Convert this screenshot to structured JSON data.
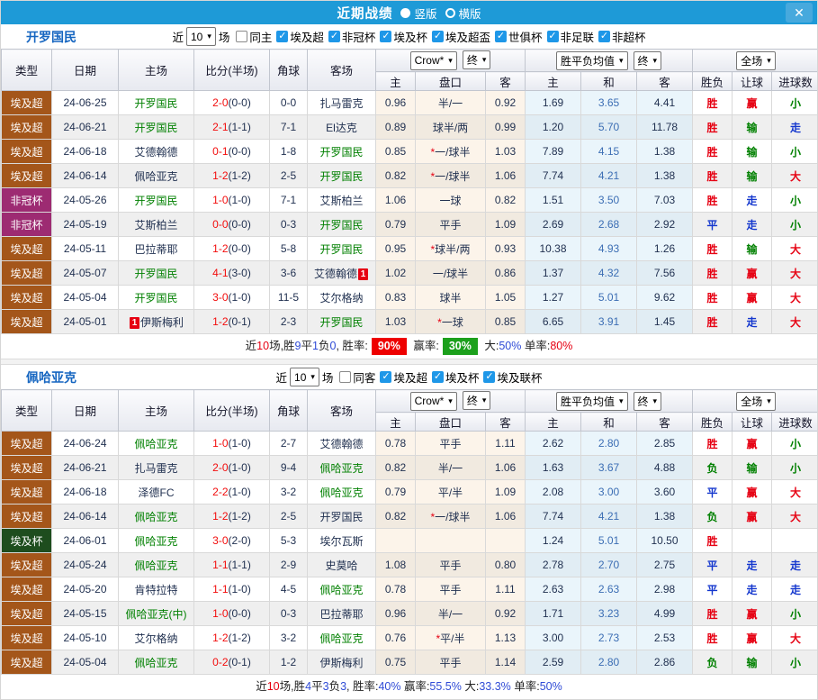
{
  "topbar": {
    "title": "近期战绩",
    "vertical_label": "竖版",
    "horizontal_label": "横版",
    "layout_selected": "竖版"
  },
  "icons": {
    "check": "✓",
    "chevron": "▾",
    "close": "✕"
  },
  "colors": {
    "topbar_bg": "#1E9AD7",
    "type": {
      "埃及超": "#A4561A",
      "非冠杯": "#9D2B72",
      "埃及杯": "#1E4D1E"
    },
    "result": {
      "胜": "#E60012",
      "赢": "#E60012",
      "大": "#E60012",
      "平": "#1437CE",
      "走": "#1437CE",
      "负": "#008000",
      "输": "#008000",
      "小": "#008000"
    }
  },
  "sections": [
    {
      "team": "开罗国民",
      "filter": {
        "near_label": "近",
        "count": "10",
        "games_label": "场",
        "same_label": "同主",
        "same_checked": false,
        "leagues": [
          "埃及超",
          "非冠杯",
          "埃及杯",
          "埃及超盃",
          "世俱杯",
          "非足联",
          "非超杯"
        ]
      },
      "header": {
        "cols": [
          "类型",
          "日期",
          "主场",
          "比分(半场)",
          "角球",
          "客场"
        ],
        "odds_select": "Crow*",
        "odds_final": "终",
        "avg_select": "胜平负均值",
        "avg_final": "终",
        "scope_select": "全场",
        "sub": [
          "主",
          "盘口",
          "客",
          "主",
          "和",
          "客",
          "胜负",
          "让球",
          "进球数"
        ]
      },
      "rows": [
        {
          "type": "埃及超",
          "date": "24-06-25",
          "home": "开罗国民",
          "hs": true,
          "hb": "",
          "hbp": "",
          "score": "2-0",
          "half": "(0-0)",
          "corner": "0-0",
          "away": "扎马雷克",
          "as": false,
          "ab": "",
          "abp": "",
          "o1": "0.96",
          "hcp": "半/一",
          "o2": "0.92",
          "a1": "1.69",
          "a2": "3.65",
          "a3": "4.41",
          "r1": "胜",
          "r2": "赢",
          "r3": "小"
        },
        {
          "type": "埃及超",
          "date": "24-06-21",
          "home": "开罗国民",
          "hs": true,
          "hb": "",
          "hbp": "",
          "score": "2-1",
          "half": "(1-1)",
          "corner": "7-1",
          "away": "El达克",
          "as": false,
          "ab": "",
          "abp": "",
          "o1": "0.89",
          "hcp": "球半/两",
          "o2": "0.99",
          "a1": "1.20",
          "a2": "5.70",
          "a3": "11.78",
          "r1": "胜",
          "r2": "输",
          "r3": "走"
        },
        {
          "type": "埃及超",
          "date": "24-06-18",
          "home": "艾德翰德",
          "hs": false,
          "hb": "",
          "hbp": "",
          "score": "0-1",
          "half": "(0-0)",
          "corner": "1-8",
          "away": "开罗国民",
          "as": true,
          "ab": "",
          "abp": "",
          "o1": "0.85",
          "hcp": "*一/球半",
          "o2": "1.03",
          "a1": "7.89",
          "a2": "4.15",
          "a3": "1.38",
          "r1": "胜",
          "r2": "输",
          "r3": "小"
        },
        {
          "type": "埃及超",
          "date": "24-06-14",
          "home": "佩哈亚克",
          "hs": false,
          "hb": "",
          "hbp": "",
          "score": "1-2",
          "half": "(1-2)",
          "corner": "2-5",
          "away": "开罗国民",
          "as": true,
          "ab": "",
          "abp": "",
          "o1": "0.82",
          "hcp": "*一/球半",
          "o2": "1.06",
          "a1": "7.74",
          "a2": "4.21",
          "a3": "1.38",
          "r1": "胜",
          "r2": "输",
          "r3": "大"
        },
        {
          "type": "非冠杯",
          "date": "24-05-26",
          "home": "开罗国民",
          "hs": true,
          "hb": "",
          "hbp": "",
          "score": "1-0",
          "half": "(1-0)",
          "corner": "7-1",
          "away": "艾斯柏兰",
          "as": false,
          "ab": "",
          "abp": "",
          "o1": "1.06",
          "hcp": "一球",
          "o2": "0.82",
          "a1": "1.51",
          "a2": "3.50",
          "a3": "7.03",
          "r1": "胜",
          "r2": "走",
          "r3": "小"
        },
        {
          "type": "非冠杯",
          "date": "24-05-19",
          "home": "艾斯柏兰",
          "hs": false,
          "hb": "",
          "hbp": "",
          "score": "0-0",
          "half": "(0-0)",
          "corner": "0-3",
          "away": "开罗国民",
          "as": true,
          "ab": "",
          "abp": "",
          "o1": "0.79",
          "hcp": "平手",
          "o2": "1.09",
          "a1": "2.69",
          "a2": "2.68",
          "a3": "2.92",
          "r1": "平",
          "r2": "走",
          "r3": "小"
        },
        {
          "type": "埃及超",
          "date": "24-05-11",
          "home": "巴拉蒂耶",
          "hs": false,
          "hb": "",
          "hbp": "",
          "score": "1-2",
          "half": "(0-0)",
          "corner": "5-8",
          "away": "开罗国民",
          "as": true,
          "ab": "",
          "abp": "",
          "o1": "0.95",
          "hcp": "*球半/两",
          "o2": "0.93",
          "a1": "10.38",
          "a2": "4.93",
          "a3": "1.26",
          "r1": "胜",
          "r2": "输",
          "r3": "大"
        },
        {
          "type": "埃及超",
          "date": "24-05-07",
          "home": "开罗国民",
          "hs": true,
          "hb": "",
          "hbp": "",
          "score": "4-1",
          "half": "(3-0)",
          "corner": "3-6",
          "away": "艾德翰德",
          "as": false,
          "ab": "1",
          "abp": "post",
          "o1": "1.02",
          "hcp": "一/球半",
          "o2": "0.86",
          "a1": "1.37",
          "a2": "4.32",
          "a3": "7.56",
          "r1": "胜",
          "r2": "赢",
          "r3": "大"
        },
        {
          "type": "埃及超",
          "date": "24-05-04",
          "home": "开罗国民",
          "hs": true,
          "hb": "",
          "hbp": "",
          "score": "3-0",
          "half": "(1-0)",
          "corner": "11-5",
          "away": "艾尔格纳",
          "as": false,
          "ab": "",
          "abp": "",
          "o1": "0.83",
          "hcp": "球半",
          "o2": "1.05",
          "a1": "1.27",
          "a2": "5.01",
          "a3": "9.62",
          "r1": "胜",
          "r2": "赢",
          "r3": "大"
        },
        {
          "type": "埃及超",
          "date": "24-05-01",
          "home": "伊斯梅利",
          "hs": false,
          "hb": "1",
          "hbp": "pre",
          "score": "1-2",
          "half": "(0-1)",
          "corner": "2-3",
          "away": "开罗国民",
          "as": true,
          "ab": "",
          "abp": "",
          "o1": "1.03",
          "hcp": "*一球",
          "o2": "0.85",
          "a1": "6.65",
          "a2": "3.91",
          "a3": "1.45",
          "r1": "胜",
          "r2": "走",
          "r3": "大"
        }
      ],
      "summary": {
        "parts": [
          {
            "t": "近",
            "c": "k"
          },
          {
            "t": "10",
            "c": "r"
          },
          {
            "t": "场,胜",
            "c": "k"
          },
          {
            "t": "9",
            "c": "b"
          },
          {
            "t": "平",
            "c": "k"
          },
          {
            "t": "1",
            "c": "b"
          },
          {
            "t": "负",
            "c": "k"
          },
          {
            "t": "0",
            "c": "b"
          },
          {
            "t": ", 胜率:",
            "c": "k"
          },
          {
            "t": "90%",
            "c": "br"
          },
          {
            "t": " 赢率:",
            "c": "k"
          },
          {
            "t": "30%",
            "c": "bg"
          },
          {
            "t": " 大:",
            "c": "k"
          },
          {
            "t": "50%",
            "c": "b"
          },
          {
            "t": " 单率:",
            "c": "k"
          },
          {
            "t": "80%",
            "c": "r"
          }
        ]
      }
    },
    {
      "team": "佩哈亚克",
      "filter": {
        "near_label": "近",
        "count": "10",
        "games_label": "场",
        "same_label": "同客",
        "same_checked": false,
        "leagues": [
          "埃及超",
          "埃及杯",
          "埃及联杯"
        ]
      },
      "header": {
        "cols": [
          "类型",
          "日期",
          "主场",
          "比分(半场)",
          "角球",
          "客场"
        ],
        "odds_select": "Crow*",
        "odds_final": "终",
        "avg_select": "胜平负均值",
        "avg_final": "终",
        "scope_select": "全场",
        "sub": [
          "主",
          "盘口",
          "客",
          "主",
          "和",
          "客",
          "胜负",
          "让球",
          "进球数"
        ]
      },
      "rows": [
        {
          "type": "埃及超",
          "date": "24-06-24",
          "home": "佩哈亚克",
          "hs": true,
          "hb": "",
          "hbp": "",
          "score": "1-0",
          "half": "(1-0)",
          "corner": "2-7",
          "away": "艾德翰德",
          "as": false,
          "ab": "",
          "abp": "",
          "o1": "0.78",
          "hcp": "平手",
          "o2": "1.11",
          "a1": "2.62",
          "a2": "2.80",
          "a3": "2.85",
          "r1": "胜",
          "r2": "赢",
          "r3": "小"
        },
        {
          "type": "埃及超",
          "date": "24-06-21",
          "home": "扎马雷克",
          "hs": false,
          "hb": "",
          "hbp": "",
          "score": "2-0",
          "half": "(1-0)",
          "corner": "9-4",
          "away": "佩哈亚克",
          "as": true,
          "ab": "",
          "abp": "",
          "o1": "0.82",
          "hcp": "半/一",
          "o2": "1.06",
          "a1": "1.63",
          "a2": "3.67",
          "a3": "4.88",
          "r1": "负",
          "r2": "输",
          "r3": "小"
        },
        {
          "type": "埃及超",
          "date": "24-06-18",
          "home": "泽德FC",
          "hs": false,
          "hb": "",
          "hbp": "",
          "score": "2-2",
          "half": "(1-0)",
          "corner": "3-2",
          "away": "佩哈亚克",
          "as": true,
          "ab": "",
          "abp": "",
          "o1": "0.79",
          "hcp": "平/半",
          "o2": "1.09",
          "a1": "2.08",
          "a2": "3.00",
          "a3": "3.60",
          "r1": "平",
          "r2": "赢",
          "r3": "大"
        },
        {
          "type": "埃及超",
          "date": "24-06-14",
          "home": "佩哈亚克",
          "hs": true,
          "hb": "",
          "hbp": "",
          "score": "1-2",
          "half": "(1-2)",
          "corner": "2-5",
          "away": "开罗国民",
          "as": false,
          "ab": "",
          "abp": "",
          "o1": "0.82",
          "hcp": "*一/球半",
          "o2": "1.06",
          "a1": "7.74",
          "a2": "4.21",
          "a3": "1.38",
          "r1": "负",
          "r2": "赢",
          "r3": "大"
        },
        {
          "type": "埃及杯",
          "date": "24-06-01",
          "home": "佩哈亚克",
          "hs": true,
          "hb": "",
          "hbp": "",
          "score": "3-0",
          "half": "(2-0)",
          "corner": "5-3",
          "away": "埃尔瓦斯",
          "as": false,
          "ab": "",
          "abp": "",
          "o1": "",
          "hcp": "",
          "o2": "",
          "a1": "1.24",
          "a2": "5.01",
          "a3": "10.50",
          "r1": "胜",
          "r2": "",
          "r3": ""
        },
        {
          "type": "埃及超",
          "date": "24-05-24",
          "home": "佩哈亚克",
          "hs": true,
          "hb": "",
          "hbp": "",
          "score": "1-1",
          "half": "(1-1)",
          "corner": "2-9",
          "away": "史莫哈",
          "as": false,
          "ab": "",
          "abp": "",
          "o1": "1.08",
          "hcp": "平手",
          "o2": "0.80",
          "a1": "2.78",
          "a2": "2.70",
          "a3": "2.75",
          "r1": "平",
          "r2": "走",
          "r3": "走"
        },
        {
          "type": "埃及超",
          "date": "24-05-20",
          "home": "肯特拉特",
          "hs": false,
          "hb": "",
          "hbp": "",
          "score": "1-1",
          "half": "(1-0)",
          "corner": "4-5",
          "away": "佩哈亚克",
          "as": true,
          "ab": "",
          "abp": "",
          "o1": "0.78",
          "hcp": "平手",
          "o2": "1.11",
          "a1": "2.63",
          "a2": "2.63",
          "a3": "2.98",
          "r1": "平",
          "r2": "走",
          "r3": "走"
        },
        {
          "type": "埃及超",
          "date": "24-05-15",
          "home": "佩哈亚克(中)",
          "hs": true,
          "hb": "",
          "hbp": "",
          "score": "1-0",
          "half": "(0-0)",
          "corner": "0-3",
          "away": "巴拉蒂耶",
          "as": false,
          "ab": "",
          "abp": "",
          "o1": "0.96",
          "hcp": "半/一",
          "o2": "0.92",
          "a1": "1.71",
          "a2": "3.23",
          "a3": "4.99",
          "r1": "胜",
          "r2": "赢",
          "r3": "小"
        },
        {
          "type": "埃及超",
          "date": "24-05-10",
          "home": "艾尔格纳",
          "hs": false,
          "hb": "",
          "hbp": "",
          "score": "1-2",
          "half": "(1-2)",
          "corner": "3-2",
          "away": "佩哈亚克",
          "as": true,
          "ab": "",
          "abp": "",
          "o1": "0.76",
          "hcp": "*平/半",
          "o2": "1.13",
          "a1": "3.00",
          "a2": "2.73",
          "a3": "2.53",
          "r1": "胜",
          "r2": "赢",
          "r3": "大"
        },
        {
          "type": "埃及超",
          "date": "24-05-04",
          "home": "佩哈亚克",
          "hs": true,
          "hb": "",
          "hbp": "",
          "score": "0-2",
          "half": "(0-1)",
          "corner": "1-2",
          "away": "伊斯梅利",
          "as": false,
          "ab": "",
          "abp": "",
          "o1": "0.75",
          "hcp": "平手",
          "o2": "1.14",
          "a1": "2.59",
          "a2": "2.80",
          "a3": "2.86",
          "r1": "负",
          "r2": "输",
          "r3": "小"
        }
      ],
      "summary": {
        "parts": [
          {
            "t": "近",
            "c": "k"
          },
          {
            "t": "10",
            "c": "r"
          },
          {
            "t": "场,胜",
            "c": "k"
          },
          {
            "t": "4",
            "c": "b"
          },
          {
            "t": "平",
            "c": "k"
          },
          {
            "t": "3",
            "c": "b"
          },
          {
            "t": "负",
            "c": "k"
          },
          {
            "t": "3",
            "c": "b"
          },
          {
            "t": ", 胜率:",
            "c": "k"
          },
          {
            "t": "40%",
            "c": "b"
          },
          {
            "t": " 赢率:",
            "c": "k"
          },
          {
            "t": "55.5%",
            "c": "b"
          },
          {
            "t": " 大:",
            "c": "k"
          },
          {
            "t": "33.3%",
            "c": "b"
          },
          {
            "t": " 单率:",
            "c": "k"
          },
          {
            "t": "50%",
            "c": "b"
          }
        ]
      }
    }
  ]
}
